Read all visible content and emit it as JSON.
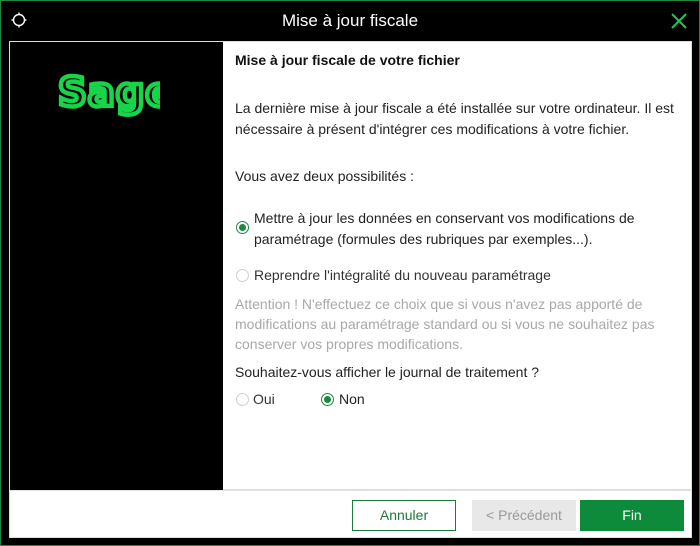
{
  "window": {
    "title": "Mise à jour fiscale"
  },
  "brand": {
    "logo_text": "Sage",
    "logo_color": "#18d44a"
  },
  "content": {
    "heading": "Mise à jour fiscale de votre fichier",
    "intro": "La dernière mise à jour fiscale a été installée sur votre ordinateur. Il est nécessaire à présent d'intégrer ces modifications à votre fichier.",
    "choices_label": "Vous avez deux possibilités :",
    "option1": {
      "label": "Mettre à jour les données en conservant vos modifications de paramétrage (formules des rubriques par exemples...).",
      "selected": true
    },
    "option2": {
      "label": "Reprendre l'intégralité du nouveau paramétrage",
      "selected": false,
      "enabled": false
    },
    "warning": "Attention ! N'effectuez ce choix que si vous n'avez pas apporté de modifications au paramétrage standard ou si vous ne souhaitez pas conserver vos propres modifications.",
    "journal_question": "Souhaitez-vous afficher le journal de traitement ?",
    "journal_options": {
      "oui": {
        "label": "Oui",
        "selected": false
      },
      "non": {
        "label": "Non",
        "selected": true
      }
    }
  },
  "footer": {
    "cancel_label": "Annuler",
    "previous_label": "< Précédent",
    "finish_label": "Fin"
  },
  "colors": {
    "accent": "#0d8a3a",
    "window_border": "#1f8a3d",
    "disabled_text": "#a8a8a8"
  }
}
